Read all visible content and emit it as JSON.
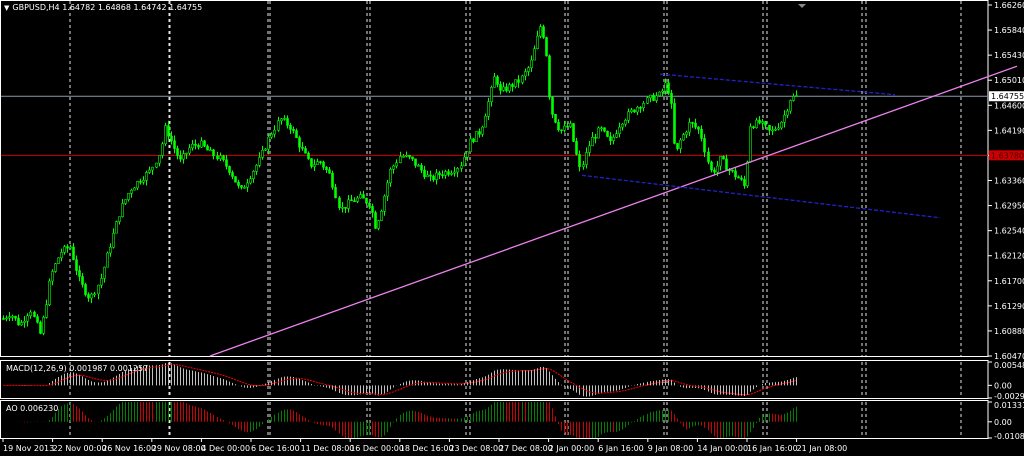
{
  "header": {
    "symbol": "GBPUSD,H4",
    "open": "1.64782",
    "high": "1.64868",
    "low": "1.64742",
    "close": "1.64755"
  },
  "colors": {
    "background": "#000000",
    "candle": "#00ff00",
    "grid": "#ffffff",
    "trendline": "#ee82ee",
    "channel": "#2222cc",
    "hline": "#cc0000",
    "bid_line": "#8899aa",
    "histogram": "#c0c0c0",
    "signal": "#ff0000",
    "ao_up": "#008000",
    "ao_down": "#cc0000"
  },
  "chart_data": [
    {
      "type": "candlestick",
      "name": "GBPUSD,H4",
      "ylim": [
        1.6047,
        1.6626
      ],
      "y_ticks": [
        "1.66260",
        "1.65840",
        "1.65430",
        "1.65010",
        "1.64600",
        "1.64190",
        "1.63780",
        "1.63360",
        "1.62950",
        "1.62540",
        "1.62120",
        "1.61700",
        "1.61290",
        "1.60880",
        "1.60470"
      ],
      "x_ticks": [
        "19 Nov 2013",
        "22 Nov 00:00",
        "26 Nov 16:00",
        "29 Nov 08:00",
        "4 Dec 00:00",
        "6 Dec 16:00",
        "11 Dec 08:00",
        "16 Dec 00:00",
        "18 Dec 16:00",
        "23 Dec 08:00",
        "27 Dec 08:00",
        "2 Jan 00:00",
        "6 Jan 16:00",
        "9 Jan 08:00",
        "14 Jan 00:00",
        "16 Jan 16:00",
        "21 Jan 08:00"
      ],
      "current_price": "1.64755",
      "hline_price": "1.63780",
      "close_path": [
        [
          0,
          1.6105
        ],
        [
          10,
          1.6118
        ],
        [
          20,
          1.6098
        ],
        [
          30,
          1.6125
        ],
        [
          40,
          1.6082
        ],
        [
          50,
          1.6178
        ],
        [
          60,
          1.6218
        ],
        [
          70,
          1.6228
        ],
        [
          80,
          1.6168
        ],
        [
          90,
          1.6142
        ],
        [
          100,
          1.6172
        ],
        [
          110,
          1.6232
        ],
        [
          120,
          1.6288
        ],
        [
          130,
          1.6322
        ],
        [
          140,
          1.6338
        ],
        [
          150,
          1.6352
        ],
        [
          160,
          1.6385
        ],
        [
          165,
          1.6425
        ],
        [
          170,
          1.6405
        ],
        [
          175,
          1.6385
        ],
        [
          180,
          1.6368
        ],
        [
          190,
          1.6392
        ],
        [
          200,
          1.6398
        ],
        [
          210,
          1.6382
        ],
        [
          220,
          1.6372
        ],
        [
          230,
          1.6352
        ],
        [
          240,
          1.6318
        ],
        [
          250,
          1.6345
        ],
        [
          260,
          1.6372
        ],
        [
          270,
          1.6412
        ],
        [
          280,
          1.6438
        ],
        [
          290,
          1.6425
        ],
        [
          300,
          1.6392
        ],
        [
          310,
          1.6362
        ],
        [
          320,
          1.6368
        ],
        [
          330,
          1.6345
        ],
        [
          340,
          1.6288
        ],
        [
          350,
          1.6302
        ],
        [
          360,
          1.6308
        ],
        [
          370,
          1.6298
        ],
        [
          375,
          1.6262
        ],
        [
          380,
          1.6282
        ],
        [
          390,
          1.6352
        ],
        [
          400,
          1.6378
        ],
        [
          410,
          1.6372
        ],
        [
          420,
          1.6355
        ],
        [
          430,
          1.6338
        ],
        [
          440,
          1.6348
        ],
        [
          450,
          1.6352
        ],
        [
          460,
          1.6362
        ],
        [
          470,
          1.6402
        ],
        [
          480,
          1.6418
        ],
        [
          490,
          1.6478
        ],
        [
          495,
          1.6512
        ],
        [
          500,
          1.6482
        ],
        [
          510,
          1.6492
        ],
        [
          520,
          1.6502
        ],
        [
          530,
          1.6528
        ],
        [
          540,
          1.6592
        ],
        [
          545,
          1.6565
        ],
        [
          550,
          1.6455
        ],
        [
          560,
          1.6418
        ],
        [
          570,
          1.6428
        ],
        [
          575,
          1.6388
        ],
        [
          580,
          1.6352
        ],
        [
          590,
          1.6402
        ],
        [
          600,
          1.6422
        ],
        [
          610,
          1.6398
        ],
        [
          620,
          1.6432
        ],
        [
          630,
          1.6448
        ],
        [
          640,
          1.6462
        ],
        [
          650,
          1.6472
        ],
        [
          660,
          1.6478
        ],
        [
          665,
          1.6495
        ],
        [
          670,
          1.6478
        ],
        [
          675,
          1.6375
        ],
        [
          680,
          1.6402
        ],
        [
          690,
          1.6432
        ],
        [
          700,
          1.6418
        ],
        [
          710,
          1.6352
        ],
        [
          715,
          1.6355
        ],
        [
          720,
          1.6372
        ],
        [
          730,
          1.6352
        ],
        [
          740,
          1.6338
        ],
        [
          745,
          1.6325
        ],
        [
          750,
          1.6428
        ],
        [
          760,
          1.6432
        ],
        [
          770,
          1.6415
        ],
        [
          780,
          1.6432
        ],
        [
          785,
          1.6448
        ],
        [
          790,
          1.6472
        ],
        [
          797,
          1.64755
        ]
      ],
      "trendline": {
        "from": [
          210,
          1.6047
        ],
        "to": [
          1017,
          1.6525
        ]
      },
      "channel": [
        {
          "from": [
            660,
            1.6512
          ],
          "to": [
            895,
            1.6478
          ]
        },
        {
          "from": [
            582,
            1.6345
          ],
          "to": [
            940,
            1.6275
          ]
        }
      ]
    },
    {
      "type": "histogram",
      "name": "MACD",
      "title": "MACD(12,26,9) 0.001987 0.001257",
      "y_ticks": [
        "0.005485",
        "0.00",
        "-0.002968"
      ],
      "ylim": [
        -0.002968,
        0.005485
      ]
    },
    {
      "type": "histogram",
      "name": "AO",
      "title": "AO 0.006230",
      "y_ticks": [
        "0.013313",
        "0.00",
        "-0.010889"
      ],
      "ylim": [
        -0.010889,
        0.013313
      ]
    }
  ]
}
